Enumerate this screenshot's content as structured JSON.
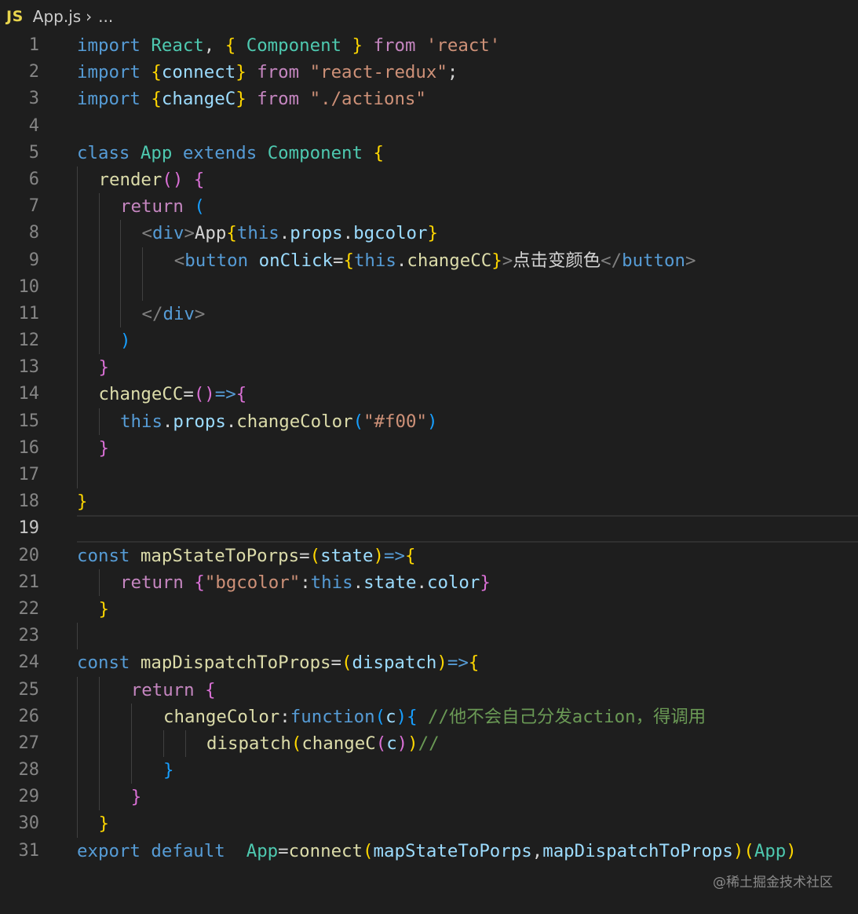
{
  "breadcrumb": {
    "file_icon": "JS",
    "file_name": "App.js",
    "separator": "›",
    "trail": "..."
  },
  "editor": {
    "current_line": 19,
    "lines": [
      {
        "n": 1,
        "indent": 0,
        "guides": [],
        "tokens": [
          [
            "kw",
            "import"
          ],
          [
            "pun",
            " "
          ],
          [
            "cls",
            "React"
          ],
          [
            "pun",
            ", "
          ],
          [
            "b1",
            "{"
          ],
          [
            "pun",
            " "
          ],
          [
            "cls",
            "Component"
          ],
          [
            "pun",
            " "
          ],
          [
            "b1",
            "}"
          ],
          [
            "pun",
            " "
          ],
          [
            "ctl",
            "from"
          ],
          [
            "pun",
            " "
          ],
          [
            "str",
            "'react'"
          ]
        ]
      },
      {
        "n": 2,
        "indent": 0,
        "guides": [],
        "tokens": [
          [
            "kw",
            "import"
          ],
          [
            "pun",
            " "
          ],
          [
            "b1",
            "{"
          ],
          [
            "var",
            "connect"
          ],
          [
            "b1",
            "}"
          ],
          [
            "pun",
            " "
          ],
          [
            "ctl",
            "from"
          ],
          [
            "pun",
            " "
          ],
          [
            "str",
            "\"react-redux\""
          ],
          [
            "pun",
            ";"
          ]
        ]
      },
      {
        "n": 3,
        "indent": 0,
        "guides": [],
        "tokens": [
          [
            "kw",
            "import"
          ],
          [
            "pun",
            " "
          ],
          [
            "b1",
            "{"
          ],
          [
            "var",
            "changeC"
          ],
          [
            "b1",
            "}"
          ],
          [
            "pun",
            " "
          ],
          [
            "ctl",
            "from"
          ],
          [
            "pun",
            " "
          ],
          [
            "str",
            "\"./actions\""
          ]
        ]
      },
      {
        "n": 4,
        "indent": 0,
        "guides": [],
        "tokens": []
      },
      {
        "n": 5,
        "indent": 0,
        "guides": [],
        "tokens": [
          [
            "kw",
            "class"
          ],
          [
            "pun",
            " "
          ],
          [
            "cls",
            "App"
          ],
          [
            "pun",
            " "
          ],
          [
            "kw",
            "extends"
          ],
          [
            "pun",
            " "
          ],
          [
            "cls",
            "Component"
          ],
          [
            "pun",
            " "
          ],
          [
            "b1",
            "{"
          ]
        ]
      },
      {
        "n": 6,
        "indent": 2,
        "guides": [
          0
        ],
        "tokens": [
          [
            "fn",
            "render"
          ],
          [
            "b2",
            "()"
          ],
          [
            "pun",
            " "
          ],
          [
            "b2",
            "{"
          ]
        ]
      },
      {
        "n": 7,
        "indent": 4,
        "guides": [
          0,
          2
        ],
        "tokens": [
          [
            "ctl",
            "return"
          ],
          [
            "pun",
            " "
          ],
          [
            "b3",
            "("
          ]
        ]
      },
      {
        "n": 8,
        "indent": 6,
        "guides": [
          0,
          2,
          4
        ],
        "tokens": [
          [
            "tag",
            "<"
          ],
          [
            "tgn",
            "div"
          ],
          [
            "tag",
            ">"
          ],
          [
            "pun",
            "App"
          ],
          [
            "b1",
            "{"
          ],
          [
            "kw",
            "this"
          ],
          [
            "pun",
            "."
          ],
          [
            "var",
            "props"
          ],
          [
            "pun",
            "."
          ],
          [
            "var",
            "bgcolor"
          ],
          [
            "b1",
            "}"
          ]
        ]
      },
      {
        "n": 9,
        "indent": 9,
        "guides": [
          0,
          2,
          4,
          6
        ],
        "tokens": [
          [
            "tag",
            "<"
          ],
          [
            "tgn",
            "button"
          ],
          [
            "pun",
            " "
          ],
          [
            "var",
            "onClick"
          ],
          [
            "pun",
            "="
          ],
          [
            "b1",
            "{"
          ],
          [
            "kw",
            "this"
          ],
          [
            "pun",
            "."
          ],
          [
            "fn",
            "changeCC"
          ],
          [
            "b1",
            "}"
          ],
          [
            "tag",
            ">"
          ],
          [
            "pun",
            "点击变颜色"
          ],
          [
            "tag",
            "</"
          ],
          [
            "tgn",
            "button"
          ],
          [
            "tag",
            ">"
          ]
        ]
      },
      {
        "n": 10,
        "indent": 0,
        "guides": [
          0,
          2,
          4,
          6
        ],
        "tokens": []
      },
      {
        "n": 11,
        "indent": 6,
        "guides": [
          0,
          2,
          4
        ],
        "tokens": [
          [
            "tag",
            "</"
          ],
          [
            "tgn",
            "div"
          ],
          [
            "tag",
            ">"
          ]
        ]
      },
      {
        "n": 12,
        "indent": 4,
        "guides": [
          0,
          2
        ],
        "tokens": [
          [
            "b3",
            ")"
          ]
        ]
      },
      {
        "n": 13,
        "indent": 2,
        "guides": [
          0
        ],
        "tokens": [
          [
            "b2",
            "}"
          ]
        ]
      },
      {
        "n": 14,
        "indent": 2,
        "guides": [
          0
        ],
        "tokens": [
          [
            "fn",
            "changeCC"
          ],
          [
            "pun",
            "="
          ],
          [
            "b2",
            "()"
          ],
          [
            "kw",
            "=>"
          ],
          [
            "b2",
            "{"
          ]
        ]
      },
      {
        "n": 15,
        "indent": 4,
        "guides": [
          0,
          2
        ],
        "tokens": [
          [
            "kw",
            "this"
          ],
          [
            "pun",
            "."
          ],
          [
            "var",
            "props"
          ],
          [
            "pun",
            "."
          ],
          [
            "fn",
            "changeColor"
          ],
          [
            "b3",
            "("
          ],
          [
            "str",
            "\"#f00\""
          ],
          [
            "b3",
            ")"
          ]
        ]
      },
      {
        "n": 16,
        "indent": 2,
        "guides": [
          0
        ],
        "tokens": [
          [
            "b2",
            "}"
          ]
        ]
      },
      {
        "n": 17,
        "indent": 0,
        "guides": [
          0
        ],
        "tokens": []
      },
      {
        "n": 18,
        "indent": 0,
        "guides": [],
        "tokens": [
          [
            "b1",
            "}"
          ]
        ]
      },
      {
        "n": 19,
        "indent": 0,
        "guides": [],
        "tokens": []
      },
      {
        "n": 20,
        "indent": 0,
        "guides": [],
        "tokens": [
          [
            "kw",
            "const"
          ],
          [
            "pun",
            " "
          ],
          [
            "fn",
            "mapStateToPorps"
          ],
          [
            "pun",
            "="
          ],
          [
            "b1",
            "("
          ],
          [
            "var",
            "state"
          ],
          [
            "b1",
            ")"
          ],
          [
            "kw",
            "=>"
          ],
          [
            "b1",
            "{"
          ]
        ]
      },
      {
        "n": 21,
        "indent": 4,
        "guides": [
          2
        ],
        "tokens": [
          [
            "ctl",
            "return"
          ],
          [
            "pun",
            " "
          ],
          [
            "b2",
            "{"
          ],
          [
            "str",
            "\"bgcolor\""
          ],
          [
            "pun",
            ":"
          ],
          [
            "kw",
            "this"
          ],
          [
            "pun",
            "."
          ],
          [
            "var",
            "state"
          ],
          [
            "pun",
            "."
          ],
          [
            "var",
            "color"
          ],
          [
            "b2",
            "}"
          ]
        ]
      },
      {
        "n": 22,
        "indent": 2,
        "guides": [],
        "tokens": [
          [
            "b1",
            "}"
          ]
        ]
      },
      {
        "n": 23,
        "indent": 0,
        "guides": [
          0
        ],
        "tokens": []
      },
      {
        "n": 24,
        "indent": 0,
        "guides": [],
        "tokens": [
          [
            "kw",
            "const"
          ],
          [
            "pun",
            " "
          ],
          [
            "fn",
            "mapDispatchToProps"
          ],
          [
            "pun",
            "="
          ],
          [
            "b1",
            "("
          ],
          [
            "var",
            "dispatch"
          ],
          [
            "b1",
            ")"
          ],
          [
            "kw",
            "=>"
          ],
          [
            "b1",
            "{"
          ]
        ]
      },
      {
        "n": 25,
        "indent": 5,
        "guides": [
          0,
          2
        ],
        "tokens": [
          [
            "ctl",
            "return"
          ],
          [
            "pun",
            " "
          ],
          [
            "b2",
            "{"
          ]
        ]
      },
      {
        "n": 26,
        "indent": 8,
        "guides": [
          0,
          2,
          5
        ],
        "tokens": [
          [
            "fn",
            "changeColor"
          ],
          [
            "pun",
            ":"
          ],
          [
            "kw",
            "function"
          ],
          [
            "b3",
            "("
          ],
          [
            "var",
            "c"
          ],
          [
            "b3",
            ")"
          ],
          [
            "b3",
            "{"
          ],
          [
            "pun",
            " "
          ],
          [
            "cmt",
            "//他不会自己分发action，得调用"
          ]
        ]
      },
      {
        "n": 27,
        "indent": 12,
        "guides": [
          0,
          2,
          5,
          8,
          10
        ],
        "tokens": [
          [
            "fn",
            "dispatch"
          ],
          [
            "b1",
            "("
          ],
          [
            "fn",
            "changeC"
          ],
          [
            "b2",
            "("
          ],
          [
            "var",
            "c"
          ],
          [
            "b2",
            ")"
          ],
          [
            "b1",
            ")"
          ],
          [
            "cmt",
            "//"
          ]
        ]
      },
      {
        "n": 28,
        "indent": 8,
        "guides": [
          0,
          2,
          5
        ],
        "tokens": [
          [
            "b3",
            "}"
          ]
        ]
      },
      {
        "n": 29,
        "indent": 5,
        "guides": [
          0,
          2
        ],
        "tokens": [
          [
            "b2",
            "}"
          ]
        ]
      },
      {
        "n": 30,
        "indent": 2,
        "guides": [
          0
        ],
        "tokens": [
          [
            "b1",
            "}"
          ]
        ]
      },
      {
        "n": 31,
        "indent": 0,
        "guides": [],
        "tokens": [
          [
            "kw",
            "export"
          ],
          [
            "pun",
            " "
          ],
          [
            "kw",
            "default"
          ],
          [
            "pun",
            "  "
          ],
          [
            "cls",
            "App"
          ],
          [
            "pun",
            "="
          ],
          [
            "fn",
            "connect"
          ],
          [
            "b1",
            "("
          ],
          [
            "var",
            "mapStateToPorps"
          ],
          [
            "pun",
            ","
          ],
          [
            "var",
            "mapDispatchToProps"
          ],
          [
            "b1",
            ")"
          ],
          [
            "b1",
            "("
          ],
          [
            "cls",
            "App"
          ],
          [
            "b1",
            ")"
          ]
        ]
      }
    ]
  },
  "watermark": "@稀土掘金技术社区"
}
